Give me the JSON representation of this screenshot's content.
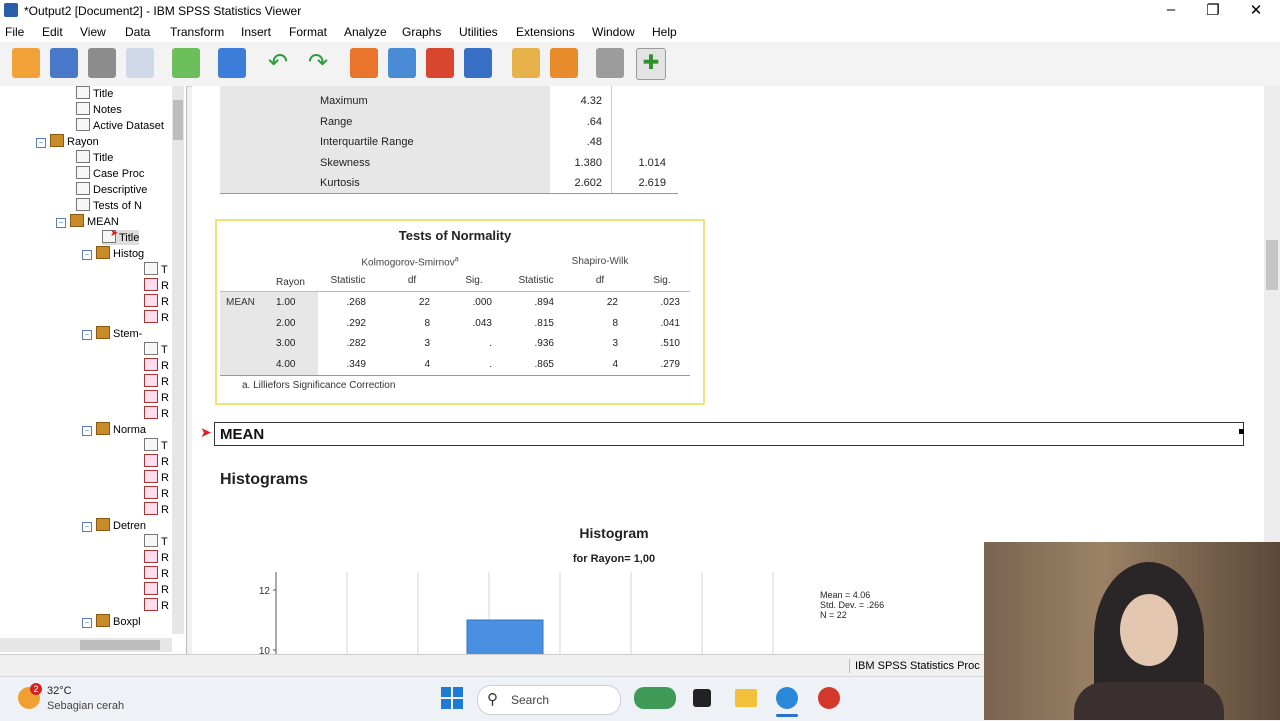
{
  "window": {
    "title": "*Output2 [Document2] - IBM SPSS Statistics Viewer"
  },
  "menu": [
    "File",
    "Edit",
    "View",
    "Data",
    "Transform",
    "Insert",
    "Format",
    "Analyze",
    "Graphs",
    "Utilities",
    "Extensions",
    "Window",
    "Help"
  ],
  "outline": {
    "items": [
      {
        "label": "Title",
        "icon": "page-icon"
      },
      {
        "label": "Notes",
        "icon": "page-icon"
      },
      {
        "label": "Active Dataset",
        "icon": "page-icon"
      },
      {
        "label": "Rayon",
        "icon": "book-icon"
      },
      {
        "label": "Title",
        "icon": "page-icon"
      },
      {
        "label": "Case Proc",
        "icon": "table-icon"
      },
      {
        "label": "Descriptive",
        "icon": "table-icon"
      },
      {
        "label": "Tests of N",
        "icon": "table-icon"
      },
      {
        "label": "MEAN",
        "icon": "book-icon"
      },
      {
        "label": "Title",
        "icon": "page-icon"
      },
      {
        "label": "Histog",
        "icon": "book-icon"
      },
      {
        "label": "T",
        "icon": "page-icon"
      },
      {
        "label": "R",
        "icon": "chart-icon"
      },
      {
        "label": "R",
        "icon": "chart-icon"
      },
      {
        "label": "R",
        "icon": "chart-icon"
      },
      {
        "label": "Stem-",
        "icon": "book-icon"
      },
      {
        "label": "T",
        "icon": "page-icon"
      },
      {
        "label": "R",
        "icon": "chart-icon"
      },
      {
        "label": "R",
        "icon": "chart-icon"
      },
      {
        "label": "R",
        "icon": "chart-icon"
      },
      {
        "label": "R",
        "icon": "chart-icon"
      },
      {
        "label": "Norma",
        "icon": "book-icon"
      },
      {
        "label": "T",
        "icon": "page-icon"
      },
      {
        "label": "R",
        "icon": "chart-icon"
      },
      {
        "label": "R",
        "icon": "chart-icon"
      },
      {
        "label": "R",
        "icon": "chart-icon"
      },
      {
        "label": "R",
        "icon": "chart-icon"
      },
      {
        "label": "Detren",
        "icon": "book-icon"
      },
      {
        "label": "T",
        "icon": "page-icon"
      },
      {
        "label": "R",
        "icon": "chart-icon"
      },
      {
        "label": "R",
        "icon": "chart-icon"
      },
      {
        "label": "R",
        "icon": "chart-icon"
      },
      {
        "label": "R",
        "icon": "chart-icon"
      },
      {
        "label": "Boxpl",
        "icon": "book-icon"
      }
    ]
  },
  "descriptives": {
    "rows": [
      {
        "label": "Maximum",
        "stat": "4.32",
        "se": ""
      },
      {
        "label": "Range",
        "stat": ".64",
        "se": ""
      },
      {
        "label": "Interquartile Range",
        "stat": ".48",
        "se": ""
      },
      {
        "label": "Skewness",
        "stat": "1.380",
        "se": "1.014"
      },
      {
        "label": "Kurtosis",
        "stat": "2.602",
        "se": "2.619"
      }
    ]
  },
  "normality": {
    "title": "Tests of Normality",
    "ks_header": "Kolmogorov-Smirnov",
    "ks_sup": "a",
    "sw_header": "Shapiro-Wilk",
    "col_rayon": "Rayon",
    "cols": [
      "Statistic",
      "df",
      "Sig.",
      "Statistic",
      "df",
      "Sig."
    ],
    "row_label": "MEAN",
    "rows": [
      {
        "rayon": "1.00",
        "v": [
          ".268",
          "22",
          ".000",
          ".894",
          "22",
          ".023"
        ]
      },
      {
        "rayon": "2.00",
        "v": [
          ".292",
          "8",
          ".043",
          ".815",
          "8",
          ".041"
        ]
      },
      {
        "rayon": "3.00",
        "v": [
          ".282",
          "3",
          ".",
          ".936",
          "3",
          ".510"
        ]
      },
      {
        "rayon": "4.00",
        "v": [
          ".349",
          "4",
          ".",
          ".865",
          "4",
          ".279"
        ]
      }
    ],
    "footnote": "a. Lilliefors Significance Correction"
  },
  "mean_heading": "MEAN",
  "histograms_heading": "Histograms",
  "chart_data": {
    "type": "bar",
    "title": "Histogram",
    "subtitle": "for Rayon= 1,00",
    "y_ticks": [
      "12",
      "10"
    ],
    "ylim": [
      10,
      12
    ],
    "visible_bar_value": 11,
    "stats": [
      "Mean = 4.06",
      "Std. Dev. = .266",
      "N = 22"
    ]
  },
  "status": {
    "text": "IBM SPSS Statistics Proc"
  },
  "taskbar": {
    "temp": "32°C",
    "weather": "Sebagian cerah",
    "badge": "2",
    "search": "Search"
  },
  "colors": {
    "bar": "#4a90e2",
    "highlight": "#f2e27a",
    "arrow": "#e02020"
  }
}
